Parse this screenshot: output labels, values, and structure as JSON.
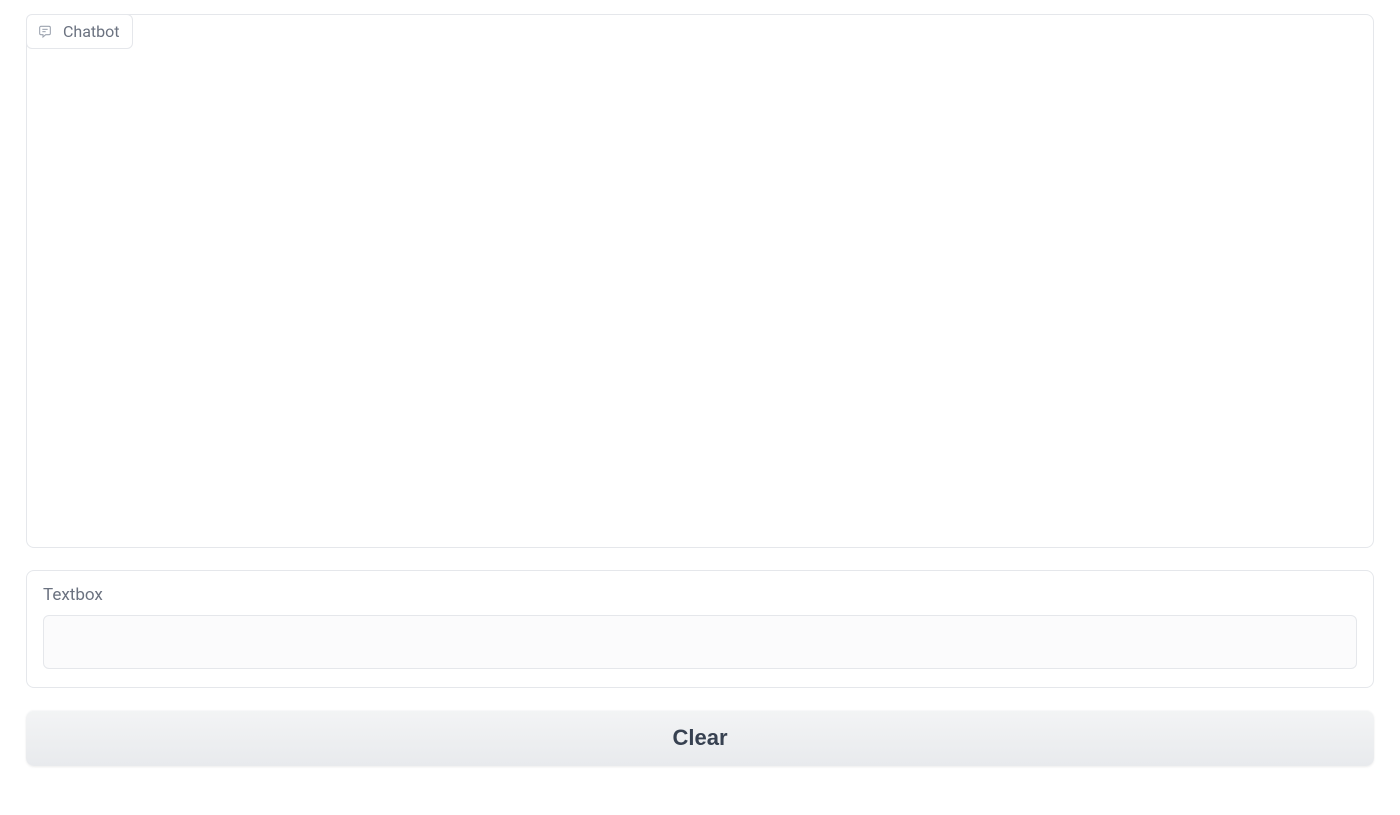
{
  "chatbot": {
    "tab_label": "Chatbot"
  },
  "textbox": {
    "label": "Textbox",
    "value": "",
    "placeholder": ""
  },
  "actions": {
    "clear_label": "Clear"
  }
}
